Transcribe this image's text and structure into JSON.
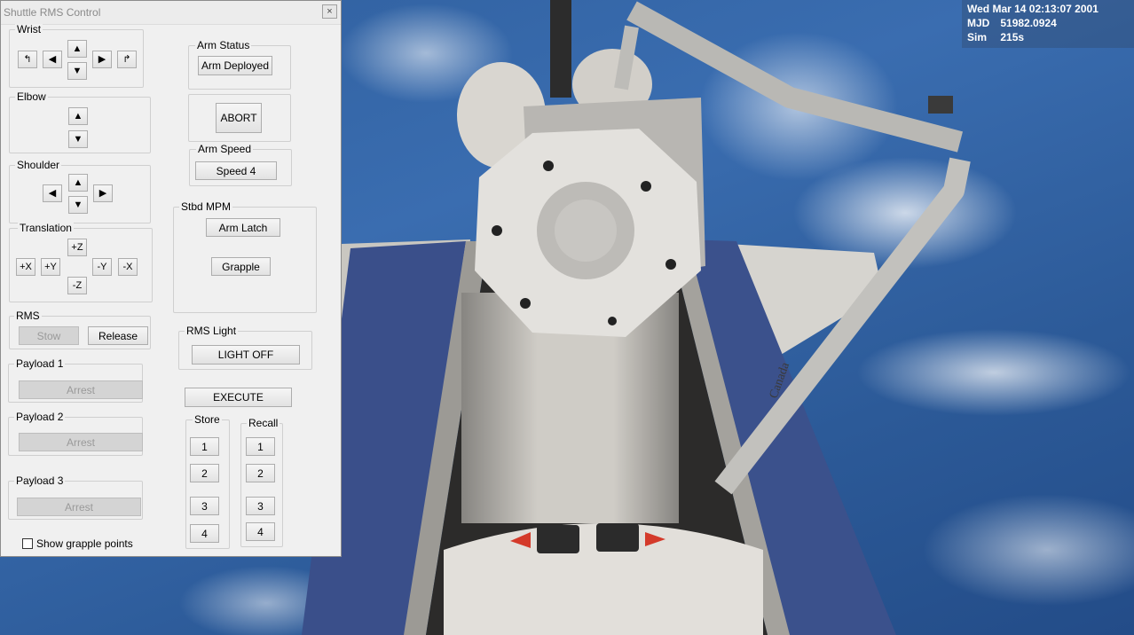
{
  "hud": {
    "date": "Wed Mar 14 02:13:07 2001",
    "mjd_label": "MJD",
    "mjd_value": "51982.0924",
    "sim_label": "Sim",
    "sim_value": "215s"
  },
  "scene": {
    "arm_decal": "Canada"
  },
  "dialog": {
    "title": "Shuttle RMS Control",
    "close_label": "×",
    "wrist": {
      "label": "Wrist",
      "icons": [
        "roll-left-icon",
        "arrow-left-icon",
        "arrow-up-icon",
        "arrow-down-icon",
        "arrow-right-icon",
        "roll-right-icon"
      ]
    },
    "elbow": {
      "label": "Elbow"
    },
    "shoulder": {
      "label": "Shoulder"
    },
    "translation": {
      "label": "Translation",
      "plus_z": "+Z",
      "minus_z": "-Z",
      "plus_x": "+X",
      "plus_y": "+Y",
      "minus_y": "-Y",
      "minus_x": "-X"
    },
    "rms": {
      "label": "RMS",
      "stow": "Stow",
      "release": "Release"
    },
    "payloads": [
      {
        "label": "Payload 1",
        "button": "Arrest"
      },
      {
        "label": "Payload 2",
        "button": "Arrest"
      },
      {
        "label": "Payload 3",
        "button": "Arrest"
      }
    ],
    "show_grapple": "Show grapple points",
    "arm_status": {
      "label": "Arm Status",
      "button": "Arm Deployed"
    },
    "abort": "ABORT",
    "arm_speed": {
      "label": "Arm Speed",
      "button": "Speed 4"
    },
    "stbd_mpm": {
      "label": "Stbd MPM",
      "arm_latch": "Arm Latch",
      "grapple": "Grapple"
    },
    "rms_light": {
      "label": "RMS Light",
      "button": "LIGHT OFF"
    },
    "execute": "EXECUTE",
    "store": {
      "label": "Store",
      "slots": [
        "1",
        "2",
        "3",
        "4"
      ]
    },
    "recall": {
      "label": "Recall",
      "slots": [
        "1",
        "2",
        "3",
        "4"
      ]
    }
  }
}
